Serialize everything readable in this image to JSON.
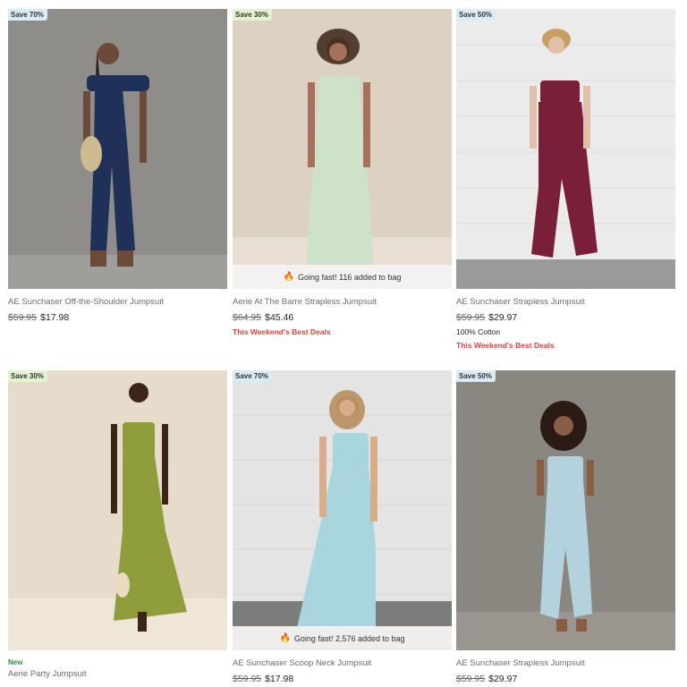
{
  "products": [
    {
      "badge": "Save 70%",
      "name": "AE Sunchaser Off-the-Shoulder Jumpsuit",
      "old_price": "$59.95",
      "price": "$17.98",
      "bg_color": "#8e8d8a",
      "garment_color": "#1f3158"
    },
    {
      "badge": "Save 30%",
      "name": "Aerie At The Barre Strapless Jumpsuit",
      "old_price": "$64.95",
      "price": "$45.46",
      "fast_text": "Going fast! 116 added to bag",
      "promo": "This Weekend's Best Deals",
      "bg_color": "#ddd2c2",
      "garment_color": "#cde2c8"
    },
    {
      "badge": "Save 50%",
      "name": "AE Sunchaser Strapless Jumpsuit",
      "old_price": "$59.95",
      "price": "$29.97",
      "extra": "100% Cotton",
      "promo": "This Weekend's Best Deals",
      "bg_color": "#ebebeb",
      "garment_color": "#7a1f38"
    },
    {
      "badge": "Save 30%",
      "new_label": "New",
      "name": "Aerie Party Jumpsuit",
      "bg_color": "#e7dccb",
      "garment_color": "#8f9e3a"
    },
    {
      "badge": "Save 70%",
      "name": "AE Sunchaser Scoop Neck Jumpsuit",
      "old_price": "$59.95",
      "price": "$17.98",
      "fast_text": "Going fast! 2,576 added to bag",
      "bg_color": "#e4e4e4",
      "garment_color": "#a8d6dc"
    },
    {
      "badge": "Save 50%",
      "name": "AE Sunchaser Strapless Jumpsuit",
      "old_price": "$59.95",
      "price": "$29.97",
      "bg_color": "#8a8781",
      "garment_color": "#b3d2de"
    }
  ]
}
